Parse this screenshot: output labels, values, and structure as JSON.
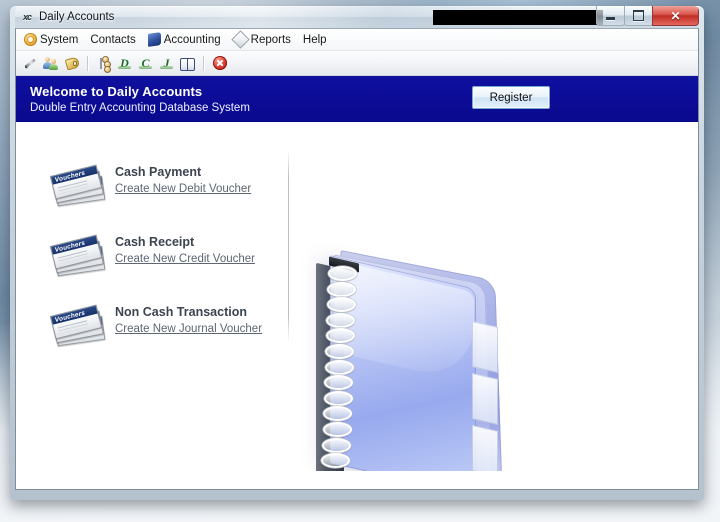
{
  "window": {
    "title": "Daily Accounts",
    "app_icon": "app-icon",
    "redaction": "",
    "controls": {
      "minimize": "",
      "maximize": "",
      "close": "✕"
    }
  },
  "menu": {
    "items": [
      {
        "label": "System",
        "icon": "settings-icon"
      },
      {
        "label": "Contacts",
        "icon": ""
      },
      {
        "label": "Accounting",
        "icon": "book-icon"
      },
      {
        "label": "Reports",
        "icon": "diamond-icon"
      },
      {
        "label": "Help",
        "icon": ""
      }
    ]
  },
  "toolbar": {
    "buttons": [
      {
        "name": "pen-icon",
        "glyph": ""
      },
      {
        "name": "contacts-icon",
        "glyph": ""
      },
      {
        "name": "tag-icon",
        "glyph": ""
      },
      {
        "name": "account-tree-icon",
        "glyph": ""
      },
      {
        "name": "debit-voucher-icon",
        "glyph": "D"
      },
      {
        "name": "credit-voucher-icon",
        "glyph": "C"
      },
      {
        "name": "journal-voucher-icon",
        "glyph": "J"
      },
      {
        "name": "ledger-book-icon",
        "glyph": ""
      },
      {
        "name": "cancel-icon",
        "glyph": ""
      }
    ]
  },
  "banner": {
    "title": "Welcome to Daily Accounts",
    "subtitle": "Double Entry Accounting Database System",
    "register_label": "Register",
    "background_color": "#0b0b96"
  },
  "main": {
    "links": [
      {
        "title": "Cash Payment",
        "action": "Create New Debit Voucher",
        "icon_label": "Vouchers"
      },
      {
        "title": "Cash Receipt",
        "action": "Create New Credit Voucher",
        "icon_label": "Vouchers"
      },
      {
        "title": "Non Cash Transaction",
        "action": "Create New Journal Voucher",
        "icon_label": "Vouchers"
      }
    ],
    "illustration": "spiral-binder-icon"
  }
}
